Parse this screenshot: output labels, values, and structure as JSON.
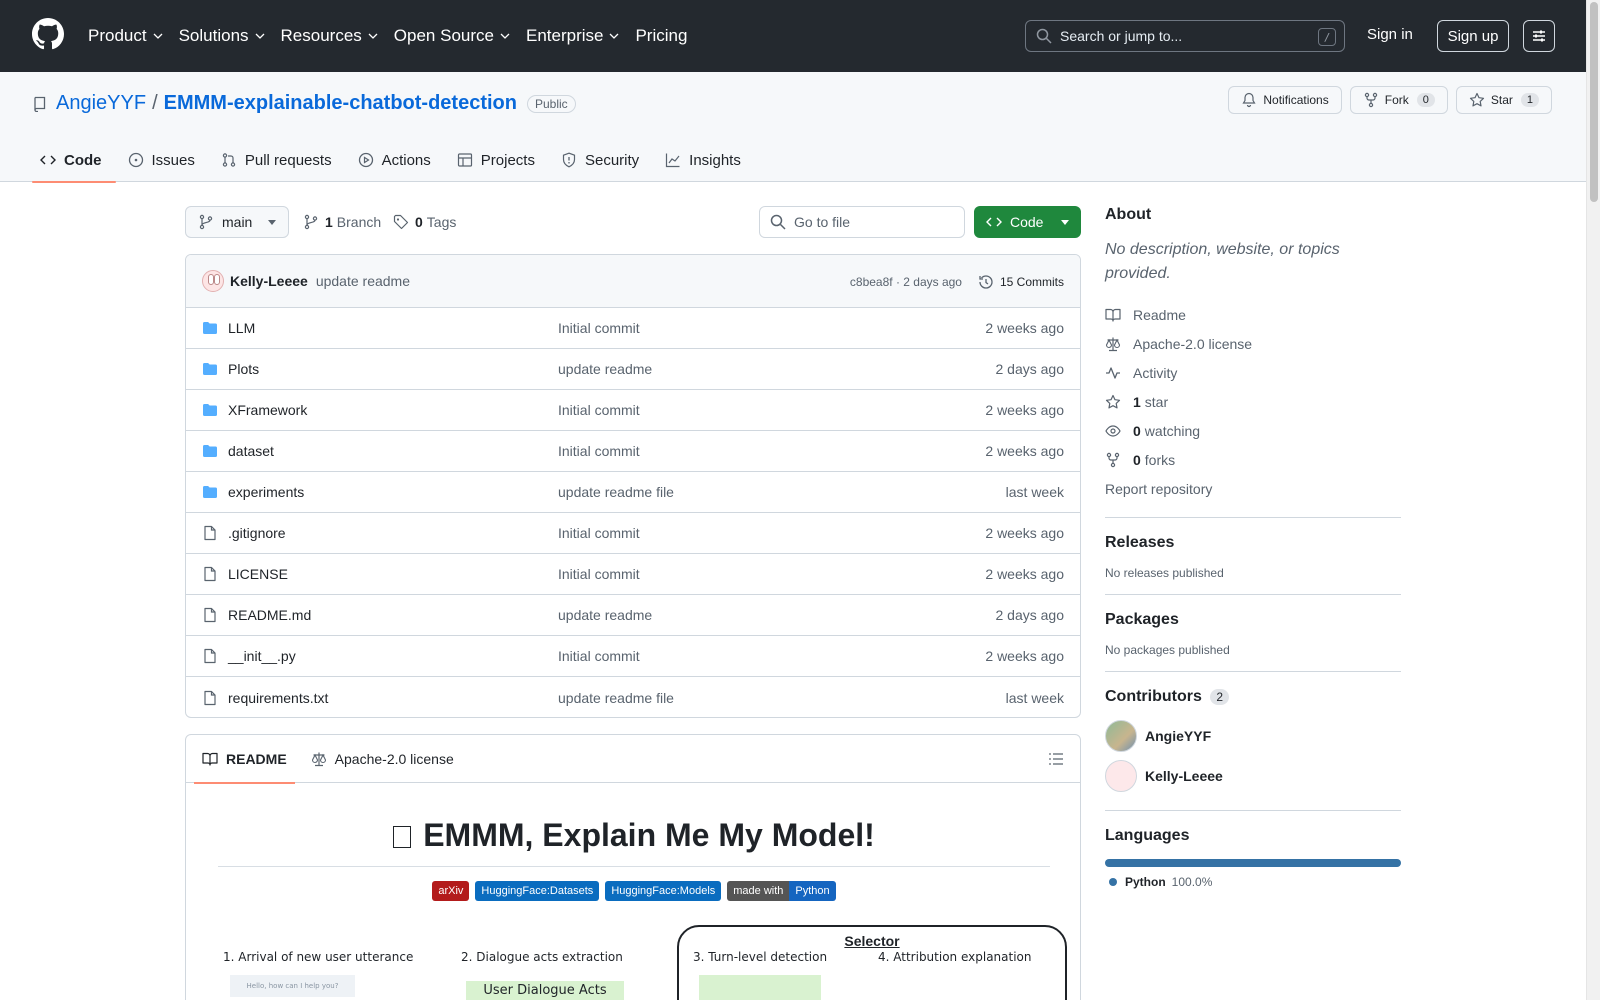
{
  "header": {
    "nav": [
      "Product",
      "Solutions",
      "Resources",
      "Open Source",
      "Enterprise",
      "Pricing"
    ],
    "search_placeholder": "Search or jump to...",
    "search_shortcut": "/",
    "signin": "Sign in",
    "signup": "Sign up"
  },
  "repo": {
    "owner": "AngieYYF",
    "separator": "/",
    "name": "EMMM-explainable-chatbot-detection",
    "visibility": "Public",
    "notifications_label": "Notifications",
    "fork_label": "Fork",
    "fork_count": "0",
    "star_label": "Star",
    "star_count": "1",
    "tabs": [
      "Code",
      "Issues",
      "Pull requests",
      "Actions",
      "Projects",
      "Security",
      "Insights"
    ]
  },
  "branchbar": {
    "branch": "main",
    "branch_count": "1",
    "branch_label": "Branch",
    "tag_count": "0",
    "tag_label": "Tags",
    "goto_placeholder": "Go to file",
    "code_label": "Code"
  },
  "latest_commit": {
    "author": "Kelly-Leeee",
    "message": "update readme",
    "meta": "c8bea8f · 2 days ago",
    "commits": "15 Commits"
  },
  "files": [
    {
      "name": "LLM",
      "type": "folder",
      "message": "Initial commit",
      "age": "2 weeks ago"
    },
    {
      "name": "Plots",
      "type": "folder",
      "message": "update readme",
      "age": "2 days ago"
    },
    {
      "name": "XFramework",
      "type": "folder",
      "message": "Initial commit",
      "age": "2 weeks ago"
    },
    {
      "name": "dataset",
      "type": "folder",
      "message": "Initial commit",
      "age": "2 weeks ago"
    },
    {
      "name": "experiments",
      "type": "folder",
      "message": "update readme file",
      "age": "last week"
    },
    {
      "name": ".gitignore",
      "type": "file",
      "message": "Initial commit",
      "age": "2 weeks ago"
    },
    {
      "name": "LICENSE",
      "type": "file",
      "message": "Initial commit",
      "age": "2 weeks ago"
    },
    {
      "name": "README.md",
      "type": "file",
      "message": "update readme",
      "age": "2 days ago"
    },
    {
      "name": "__init__.py",
      "type": "file",
      "message": "Initial commit",
      "age": "2 weeks ago"
    },
    {
      "name": "requirements.txt",
      "type": "file",
      "message": "update readme file",
      "age": "last week"
    }
  ],
  "readme": {
    "tab_readme": "README",
    "tab_license": "Apache-2.0 license",
    "title": "EMMM, Explain Me My Model!",
    "badges": [
      {
        "left": "arXiv",
        "right": "",
        "left_color": "#b31b1b",
        "right_color": ""
      },
      {
        "left": "HuggingFace:Datasets",
        "right": "",
        "left_color": "#0a6cbf",
        "right_color": ""
      },
      {
        "left": "HuggingFace:Models",
        "right": "",
        "left_color": "#0a6cbf",
        "right_color": ""
      },
      {
        "left": "made with",
        "right": "Python",
        "left_color": "#555555",
        "right_color": "#1565c0"
      }
    ],
    "figure": {
      "step1": "1. Arrival of new user utterance",
      "step2": "2. Dialogue acts extraction",
      "selector": "Selector",
      "step3": "3. Turn-level detection",
      "step4": "4. Attribution explanation",
      "chat_bubble": "Hello, how can I help you?",
      "acts_box": "User Dialogue Acts"
    }
  },
  "sidebar": {
    "about_title": "About",
    "description": "No description, website, or topics provided.",
    "items": [
      {
        "icon": "book-icon",
        "bold": "",
        "text": "Readme"
      },
      {
        "icon": "law-icon",
        "bold": "",
        "text": "Apache-2.0 license"
      },
      {
        "icon": "pulse-icon",
        "bold": "",
        "text": "Activity"
      },
      {
        "icon": "star-icon",
        "bold": "1",
        "text": "star"
      },
      {
        "icon": "eye-icon",
        "bold": "0",
        "text": "watching"
      },
      {
        "icon": "fork-icon",
        "bold": "0",
        "text": "forks"
      }
    ],
    "report": "Report repository",
    "releases_title": "Releases",
    "releases_text": "No releases published",
    "packages_title": "Packages",
    "packages_text": "No packages published",
    "contributors_title": "Contributors",
    "contributors_count": "2",
    "contributors": [
      "AngieYYF",
      "Kelly-Leeee"
    ],
    "languages_title": "Languages",
    "language": "Python",
    "language_pct": "100.0%",
    "language_color": "#3572A5"
  }
}
